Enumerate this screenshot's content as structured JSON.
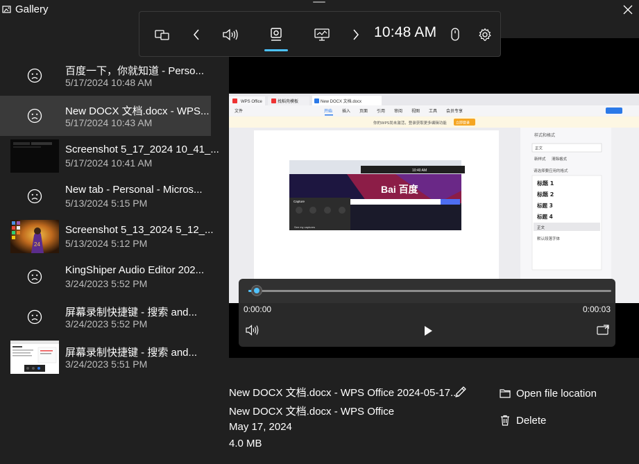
{
  "window": {
    "title": "Gallery",
    "icon": "gallery-icon",
    "close_icon": "close-icon"
  },
  "game_bar": {
    "time": "10:48 AM",
    "icons": [
      "widget-menu-icon",
      "chevron-left-icon",
      "audio-icon",
      "capture-icon",
      "performance-icon",
      "chevron-right-icon",
      "mouse-icon",
      "gear-icon"
    ],
    "active_widget": "capture"
  },
  "gallery": {
    "items": [
      {
        "name": "百度一下，你就知道 - Perso...",
        "date": "5/17/2024 10:48 AM",
        "thumb": "sad-face"
      },
      {
        "name": "New DOCX 文档.docx - WPS...",
        "date": "5/17/2024 10:43 AM",
        "thumb": "sad-face",
        "selected": true
      },
      {
        "name": "Screenshot 5_17_2024 10_41_...",
        "date": "5/17/2024 10:41 AM",
        "thumb": "screenshot-dark"
      },
      {
        "name": "New tab - Personal - Micros...",
        "date": "5/13/2024 5:15 PM",
        "thumb": "sad-face"
      },
      {
        "name": "Screenshot 5_13_2024 5_12_...",
        "date": "5/13/2024 5:12 PM",
        "thumb": "screenshot-desktop"
      },
      {
        "name": "KingShiper Audio Editor 202...",
        "date": "3/24/2023 5:52 PM",
        "thumb": "sad-face"
      },
      {
        "name": "屏幕录制快捷键 - 搜索 and...",
        "date": "3/24/2023 5:52 PM",
        "thumb": "sad-face"
      },
      {
        "name": "屏幕录制快捷键 - 搜索 and...",
        "date": "3/24/2023 5:51 PM",
        "thumb": "screenshot-doc"
      }
    ]
  },
  "player": {
    "current_time": "0:00:00",
    "duration": "0:00:03",
    "progress_fraction": 0.02
  },
  "document_preview": {
    "tabs": [
      "WPS Office",
      "找稻壳模板",
      "New DOCX 文档.docx"
    ],
    "menu": [
      "文件",
      "开始",
      "插入",
      "页面",
      "引用",
      "审阅",
      "视图",
      "工具",
      "会员专享"
    ],
    "notice": "你的WPS尚未激活，登录获取更多编辑功能",
    "notice_button": "立即登录",
    "pane_title": "样式和格式",
    "pane_current": "正文",
    "pane_new": "新样式",
    "pane_clear": "清除格式",
    "pane_hint": "请选择要应用的格式",
    "styles": [
      "标题 1",
      "标题 2",
      "标题 3",
      "标题 4",
      "正文",
      "默认段落字体"
    ],
    "baidu_logo": "Bai 百度",
    "inner_time": "10:40 AM",
    "inner_capture_title": "Capture",
    "inner_see_captures": "See my captures"
  },
  "details": {
    "title": "New DOCX 文档.docx - WPS Office 2024-05-17...",
    "app": "New DOCX 文档.docx - WPS Office",
    "date": "May 17, 2024",
    "size": "4.0 MB",
    "open_location": "Open file location",
    "delete": "Delete"
  },
  "colors": {
    "background": "#202020",
    "selected": "#3a3a3a",
    "accent": "#4cc2ff",
    "secondary_text": "#bdbdbd"
  }
}
